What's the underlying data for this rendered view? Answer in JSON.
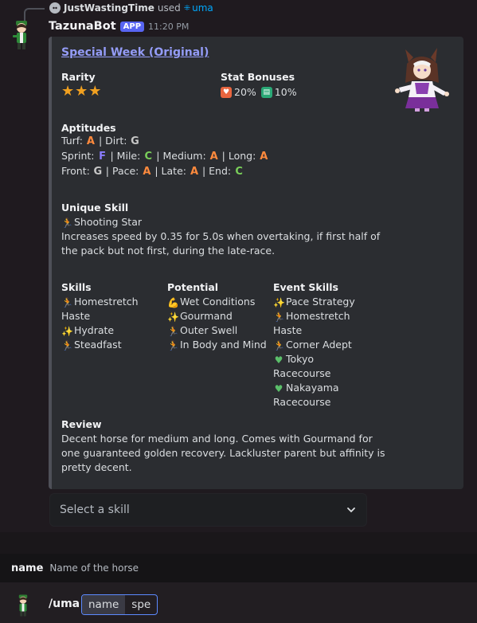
{
  "reply": {
    "user": "JustWastingTime",
    "used": "used",
    "command": "uma"
  },
  "message": {
    "bot_name": "TazunaBot",
    "badge": "APP",
    "time": "11:20 PM"
  },
  "embed": {
    "title": "Special Week (Original)",
    "rarity_label": "Rarity",
    "rarity_stars": 3,
    "stat_bonuses_label": "Stat Bonuses",
    "bonus_1": "20%",
    "bonus_2": "10%",
    "aptitudes_label": "Aptitudes",
    "aptitudes": {
      "turf": "Turf:",
      "turf_grade": "A",
      "dirt": "| Dirt:",
      "dirt_grade": "G",
      "sprint": "Sprint:",
      "sprint_grade": "F",
      "mile": "| Mile:",
      "mile_grade": "C",
      "medium": "| Medium:",
      "medium_grade": "A",
      "long": "| Long:",
      "long_grade": "A",
      "front": "Front:",
      "front_grade": "G",
      "pace": "| Pace:",
      "pace_grade": "A",
      "late": "| Late:",
      "late_grade": "A",
      "end": "| End:",
      "end_grade": "C"
    },
    "unique_skill_label": "Unique Skill",
    "unique_skill_name": "Shooting Star",
    "unique_skill_desc_1": "Increases speed by 0.35 for 5.0s when overtaking, if first half of",
    "unique_skill_desc_2": "the pack but not first, during the late-race.",
    "skills_label": "Skills",
    "skills": [
      "Homestretch",
      "Haste",
      "Hydrate",
      "Steadfast"
    ],
    "potential_label": "Potential",
    "potential": [
      "Wet Conditions",
      "Gourmand",
      "Outer Swell",
      "In Body and Mind"
    ],
    "event_skills_label": "Event Skills",
    "event_skills": [
      "Pace Strategy",
      "Homestretch",
      "Haste",
      "Corner Adept",
      "Tokyo",
      "Racecourse",
      "Nakayama",
      "Racecourse"
    ],
    "review_label": "Review",
    "review_1": "Decent horse for medium and long. Comes with Gourmand for",
    "review_2": "one guaranteed golden recovery. Lackluster parent but affinity is",
    "review_3": "pretty decent."
  },
  "select": {
    "placeholder": "Select a skill"
  },
  "option_hint": {
    "name": "name",
    "desc": "Name of the horse"
  },
  "composer": {
    "command": "/uma",
    "chip_1": "name",
    "chip_2": "spe"
  },
  "colors": {
    "accent": "#5865f2",
    "link": "#949cf7",
    "grade_a": "#ff8a3d"
  }
}
